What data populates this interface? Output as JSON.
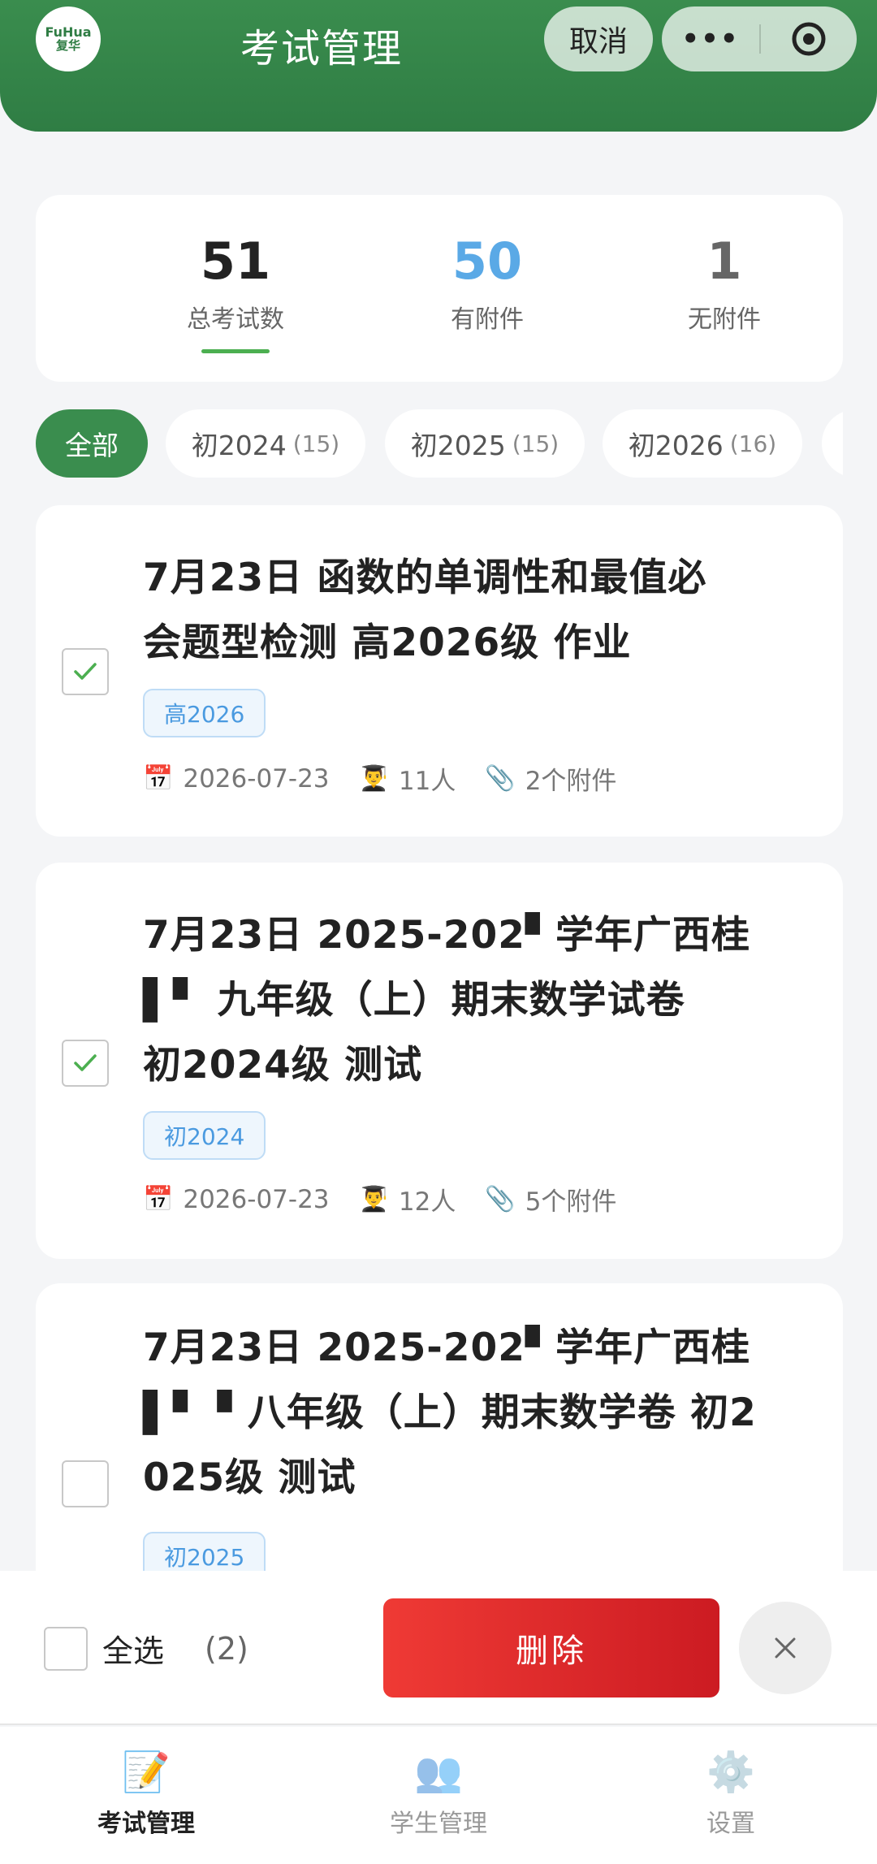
{
  "header": {
    "title": "考试管理",
    "logo_text_top": "FuHua",
    "logo_text_bottom": "复华",
    "cancel_label": "取消",
    "more_glyph": "•••"
  },
  "stats": {
    "total": {
      "value": "51",
      "label": "总考试数"
    },
    "with_attachments": {
      "value": "50",
      "label": "有附件"
    },
    "without_attachments": {
      "value": "1",
      "label": "无附件"
    }
  },
  "filters": [
    {
      "label": "全部",
      "count": ""
    },
    {
      "label": "初2024",
      "count": "(15)"
    },
    {
      "label": "初2025",
      "count": "(15)"
    },
    {
      "label": "初2026",
      "count": "(16)"
    }
  ],
  "exams": [
    {
      "title_lines": [
        "7月23日 函数的单调性和最值必",
        "会题型检测 高2026级 作业"
      ],
      "tag": "高2026",
      "date": "2026-07-23",
      "people": "11人",
      "attachments": "2个附件",
      "checked": true
    },
    {
      "title_lines": [
        "7月23日 2025-202▘学年广西桂",
        "▌▘  九年级（上）期末数学试卷",
        "初2024级 测试"
      ],
      "tag": "初2024",
      "date": "2026-07-23",
      "people": "12人",
      "attachments": "5个附件",
      "checked": true
    },
    {
      "title_lines": [
        "7月23日 2025-202▘学年广西桂",
        "▌▘  ▘八年级（上）期末数学卷 初2",
        "025级 测试"
      ],
      "tag": "初2025",
      "checked": false
    }
  ],
  "bottom_bar": {
    "select_all_label": "全选",
    "selected_count": "(2)",
    "delete_label": "删除"
  },
  "tabbar": [
    {
      "label": "考试管理",
      "icon": "memo-icon"
    },
    {
      "label": "学生管理",
      "icon": "users-icon"
    },
    {
      "label": "设置",
      "icon": "gear-icon"
    }
  ],
  "colors": {
    "brand_green": "#3a8d4e",
    "stat_blue": "#5aa9e6",
    "delete_red": "#e0262b"
  }
}
